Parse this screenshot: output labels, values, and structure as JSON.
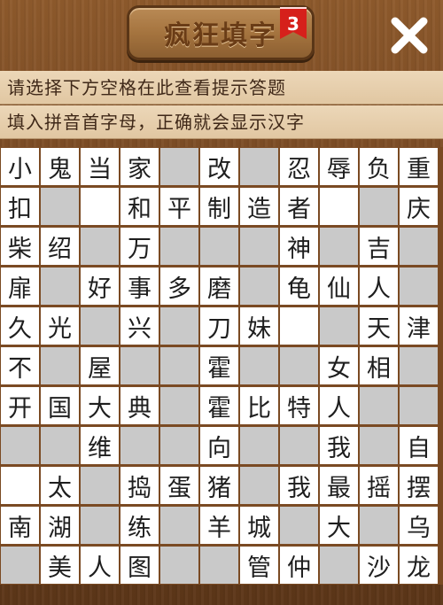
{
  "header": {
    "title": "疯狂填字",
    "level": "3",
    "close_icon": "close-x-icon"
  },
  "hints": {
    "line1": "请选择下方空格在此查看提示答题",
    "line2": "填入拼音首字母，正确就会显示汉字"
  },
  "grid": {
    "rows": [
      [
        "小",
        "鬼",
        "当",
        "家",
        "#",
        "改",
        "#",
        "忍",
        "辱",
        "负",
        "重"
      ],
      [
        "扣",
        "#",
        "",
        "和",
        "平",
        "制",
        "造",
        "者",
        "",
        "#",
        "庆"
      ],
      [
        "柴",
        "绍",
        "#",
        "万",
        "#",
        "#",
        "#",
        "神",
        "#",
        "吉",
        "#"
      ],
      [
        "扉",
        "#",
        "好",
        "事",
        "多",
        "磨",
        "#",
        "龟",
        "仙",
        "人",
        "#"
      ],
      [
        "久",
        "光",
        "#",
        "兴",
        "#",
        "刀",
        "妹",
        "",
        "#",
        "天",
        "津"
      ],
      [
        "不",
        "#",
        "屋",
        "#",
        "#",
        "霍",
        "#",
        "#",
        "女",
        "相",
        "#"
      ],
      [
        "开",
        "国",
        "大",
        "典",
        "#",
        "霍",
        "比",
        "特",
        "人",
        "#",
        "#"
      ],
      [
        "#",
        "#",
        "维",
        "#",
        "#",
        "向",
        "#",
        "#",
        "我",
        "#",
        "自"
      ],
      [
        "",
        "太",
        "#",
        "捣",
        "蛋",
        "猪",
        "#",
        "我",
        "最",
        "摇",
        "摆"
      ],
      [
        "南",
        "湖",
        "#",
        "练",
        "#",
        "羊",
        "城",
        "#",
        "大",
        "#",
        "乌"
      ],
      [
        "#",
        "美",
        "人",
        "图",
        "#",
        "#",
        "管",
        "仲",
        "#",
        "沙",
        "龙"
      ]
    ]
  }
}
